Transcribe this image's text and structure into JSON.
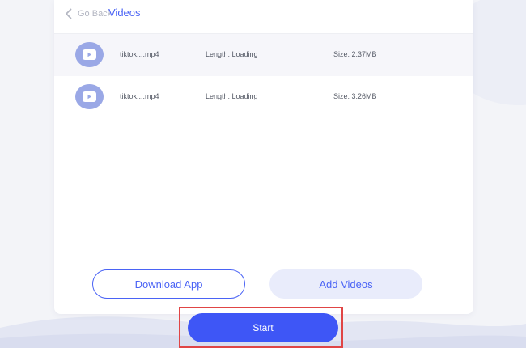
{
  "header": {
    "back_label": "Go Back",
    "title": "Videos"
  },
  "videos": [
    {
      "name": "tiktok....mp4",
      "length": "Length: Loading",
      "size": "Size: 2.37MB"
    },
    {
      "name": "tiktok....mp4",
      "length": "Length: Loading",
      "size": "Size: 3.26MB"
    }
  ],
  "footer": {
    "download_label": "Download App",
    "add_label": "Add Videos"
  },
  "start_label": "Start",
  "colors": {
    "accent": "#4a63f5",
    "start_button": "#3e56f6",
    "highlight_box": "#e04545",
    "play_icon_bg": "#9aa8e6"
  },
  "icons": {
    "back": "chevron-left-icon",
    "video": "play-icon"
  }
}
